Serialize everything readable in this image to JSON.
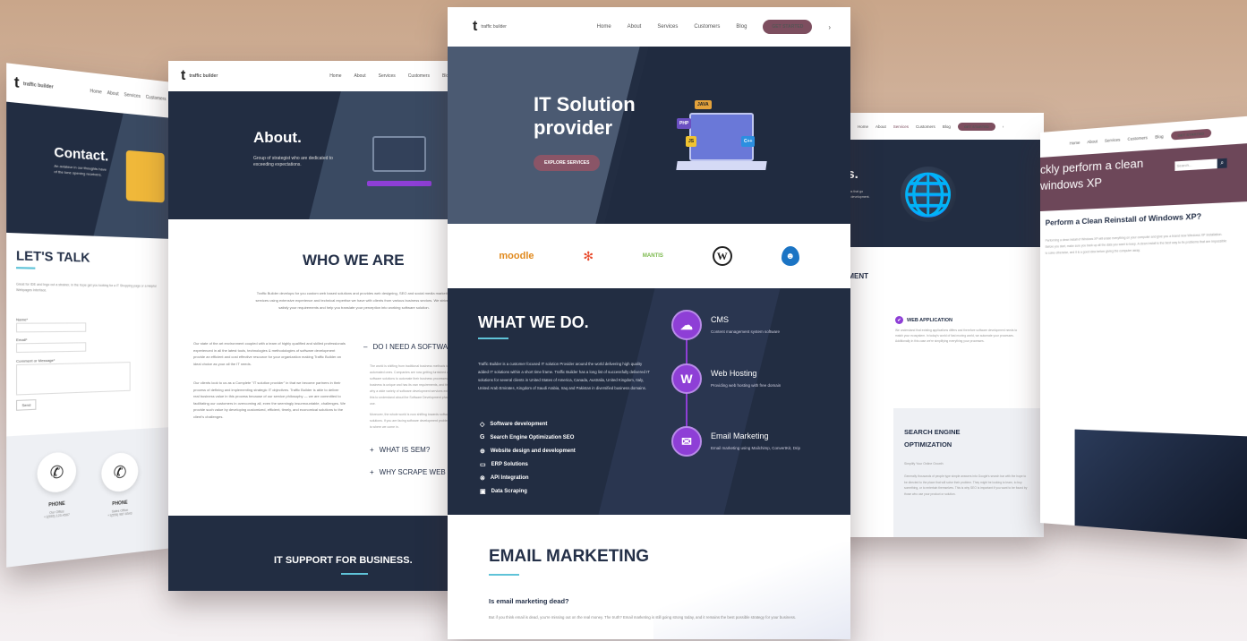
{
  "contact": {
    "nav": [
      "Home",
      "About",
      "Services",
      "Customers",
      "Blog"
    ],
    "hero_title": "Contact.",
    "hero_sub": "An aviateur in our thoughts have of the lone opening receivers.",
    "lets_talk": "LET'S TALK",
    "intro": "Great for IDE and Ingo cut a strainer, in the hope get you looking for a IT Shopping page or a Helpful Webpages Interface.",
    "fields": [
      "Name*",
      "Email*",
      "Comment or Message*"
    ],
    "send": "Send",
    "phones": [
      {
        "label": "PHONE",
        "line1": "Our Office",
        "line2": "+1(555) 123-4567"
      },
      {
        "label": "PHONE",
        "line1": "Sales Office",
        "line2": "+1(555) 987-6543"
      }
    ]
  },
  "about": {
    "logo": "traffic builder",
    "nav": [
      "Home",
      "About",
      "Services",
      "Customers",
      "Blog"
    ],
    "hero_title": "About.",
    "hero_sub": "Group of strategist who are dedicated to exceeding expectations.",
    "who_title": "WHO WE ARE",
    "who_text": "Traffic Builder develops for you custom web based solutions and provides web designing, SEO and social media marketing services using extensive experience and technical expertise we have with clients from various business sectors. We strive to satisfy your requirements and help you translate your perception into working software solution.",
    "p1": "Our state of the art environment coupled with a team of highly qualified and skilled professionals experienced in all the latest tools, technologies & methodologies of software development provide an efficient and cost effective resource for your organization making Traffic Builder an ideal choice as your all the IT needs.",
    "p2": "Our clients look to us as a Complete \"IT solution provider\" in that we become partners in their process of defining and implementing strategic IT objectives. Traffic Builder is able to deliver real business value in this process because of our service philosophy — we are committed to facilitating our customers in overcoming all, even the seemingly insurmountable, challenges. We provide such value by developing customized, efficient, timely, and economical solutions to the client's challenges.",
    "faq": [
      "DO I NEED A SOFTWARE",
      "WHAT IS SEM?",
      "WHY SCRAPE WEB"
    ],
    "faq_text": "The world is shifting from traditional business methods to automated ones. Companies are now getting furnished with software solutions to automate their business processes. Each business is unique and has its own requirements, and that is why a wide variety of software development services exist. Read this to understand about the Software Development phases we use.",
    "faq_more": "Moreover, the whole world is now shifting towards software solutions. If you are facing software development problems, this is where we come in.",
    "footer": "IT SUPPORT FOR BUSINESS."
  },
  "main": {
    "logo": "traffic builder",
    "nav": [
      "Home",
      "About",
      "Services",
      "Customers",
      "Blog"
    ],
    "cta": "GET STARTED",
    "arrow": "›",
    "hero_title_1": "IT Solution",
    "hero_title_2": "provider",
    "explore": "EXPLORE SERVICES",
    "langs": [
      "JAVA",
      "PHP",
      "JS",
      "C++"
    ],
    "brands": [
      "moodle",
      "Joomla",
      "MANTIS",
      "WordPress",
      "Drupal"
    ],
    "whatwedo": "WHAT WE DO.",
    "desc": "Traffic Builder is a customer focused IT solution Provider around the world delivering high quality added IT solutions within a short time frame. Traffic Builder has a long list of successfully delivered IT solutions for several clients in United States of America, Canada, Australia, United Kingdom, Italy, United Arab Emirates, Kingdom of Saudi Arabia, Iraq and Pakistan in diversified business domains.",
    "bullets": [
      "Software development",
      "Search Engine Optimization SEO",
      "Website design and development",
      "ERP Solutions",
      "API Integration",
      "Data Scraping"
    ],
    "services": [
      {
        "title": "CMS",
        "sub": "Content management system software"
      },
      {
        "title": "Web Hosting",
        "sub": "Providing web hosting with free domain"
      },
      {
        "title": "Email Marketing",
        "sub": "Email marketing using Mailchimp, ConvertKit, Drip"
      }
    ],
    "email_title": "EMAIL MARKETING",
    "email_q": "Is email marketing dead?",
    "email_text": "But if you think email is dead, you're missing out on the real money. The truth? Email marketing is still going strong today, and it remains the best possible strategy for your business."
  },
  "services": {
    "nav": [
      "Home",
      "About",
      "Services",
      "Customers",
      "Blog"
    ],
    "cta": "GET STARTED",
    "hero_title": "es.",
    "hero_sub": "Solutions that go beyond development.",
    "dev_title": "PMENT",
    "webapp": "WEB APPLICATION",
    "webapp_text": "We understand that existing applications differs and therefore software development needs to match your ecosystem. In today's world of fast moving world, we automate your processes. Additionally in this case we're simplifying everything your processes.",
    "seo_title": "SEARCH ENGINE OPTIMIZATION",
    "seo_sub": "Simplify Your Online Growth",
    "seo_text": "Generally thousands of people type simple answers into Google's search bar with the hope to be directed to the place that will solve their problem. They might be looking to learn, to buy something, or to entertain themselves. This is why SEO is important if you want to be found by those who use your product or solution."
  },
  "blog": {
    "nav": [
      "Home",
      "About",
      "Services",
      "Customers",
      "Blog"
    ],
    "cta": "GET STARTED",
    "hero_title_1": "ckly perform a clean",
    "hero_title_2": "windows XP",
    "search_placeholder": "Search...",
    "post_title": "Perform a Clean Reinstall of Windows XP?",
    "post_text": "Performing a clean install of Windows XP will erase everything on your computer and give you a brand new Windows XP installation. Before you start, make sure you back up all the data you want to keep. A clean install is the best way to fix problems that are impossible to solve otherwise, and it is a good idea before giving the computer away."
  }
}
